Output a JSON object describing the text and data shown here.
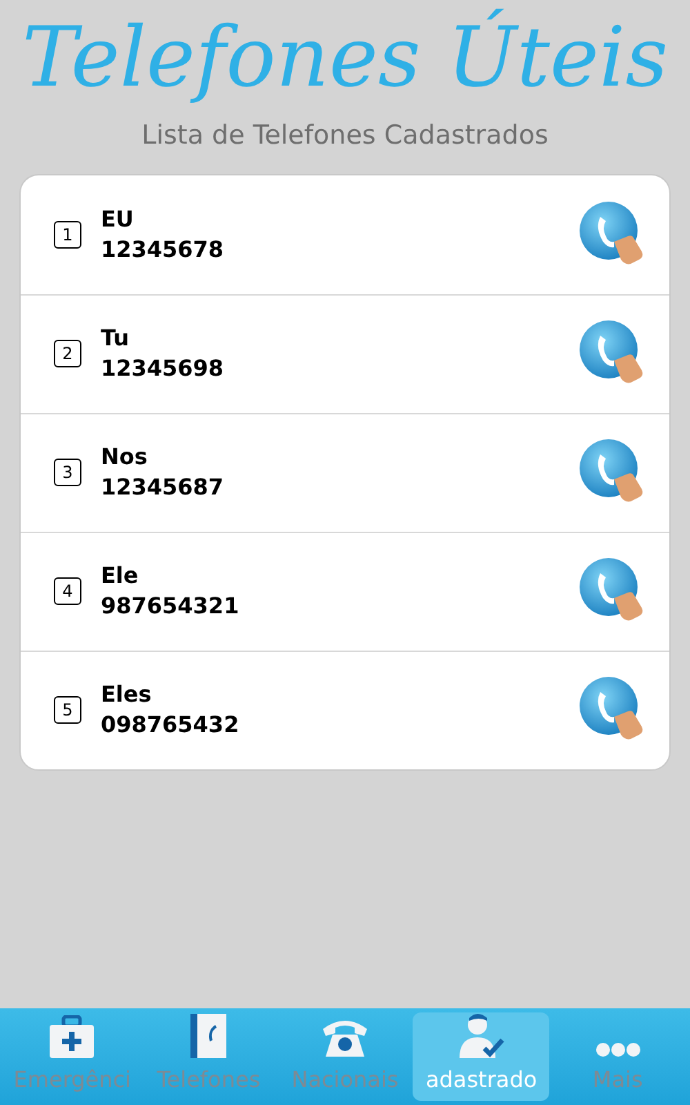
{
  "header": {
    "title": "Telefones Úteis",
    "subtitle": "Lista de Telefones Cadastrados"
  },
  "contacts": [
    {
      "index": "1",
      "name": "EU",
      "phone": "12345678"
    },
    {
      "index": "2",
      "name": "Tu",
      "phone": "12345698"
    },
    {
      "index": "3",
      "name": "Nos",
      "phone": "12345687"
    },
    {
      "index": "4",
      "name": "Ele",
      "phone": "987654321"
    },
    {
      "index": "5",
      "name": "Eles",
      "phone": "098765432"
    }
  ],
  "tabs": [
    {
      "kind": "medkit",
      "label": "Emergênci",
      "selected": false
    },
    {
      "kind": "book",
      "label": "Telefones",
      "selected": false
    },
    {
      "kind": "phone",
      "label": "Nacionais",
      "selected": false
    },
    {
      "kind": "user",
      "label": "adastrado",
      "selected": true
    },
    {
      "kind": "more",
      "label": "Mais",
      "selected": false
    }
  ]
}
